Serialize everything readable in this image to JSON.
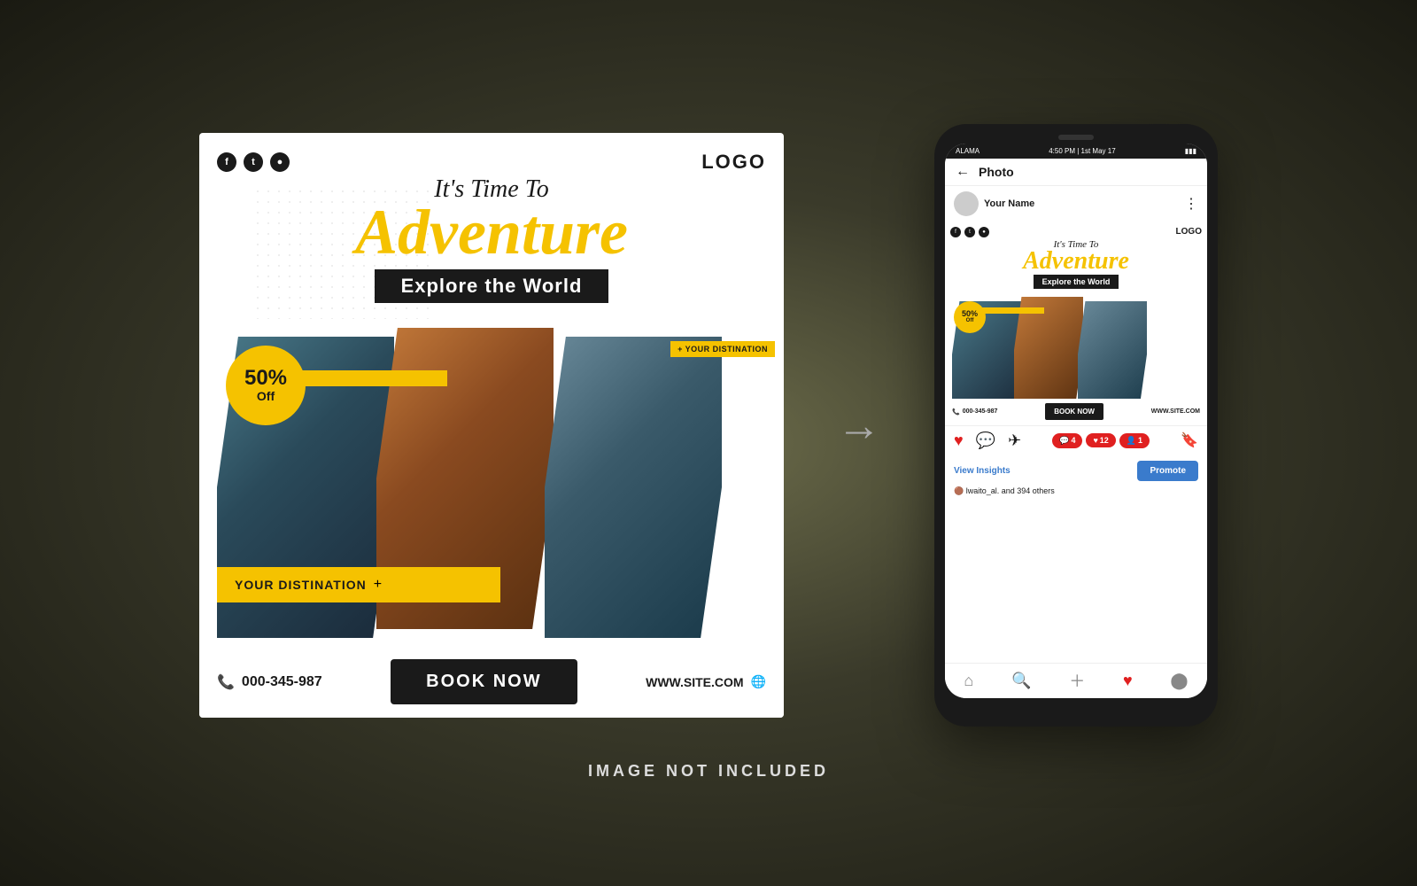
{
  "background": {
    "color": "#3a3a2a"
  },
  "left_card": {
    "social_icons": [
      "f",
      "t",
      "in"
    ],
    "logo": "LOGO",
    "its_time": "It's Time To",
    "adventure": "Adventure",
    "explore": "Explore the World",
    "discount_pct": "50%",
    "discount_off": "Off",
    "your_destination": "YOUR DISTINATION",
    "phone": "000-345-987",
    "book_now": "BOOK NOW",
    "website": "WWW.SITE.COM",
    "your_destination_corner": "+ YOUR DISTINATION"
  },
  "arrow": "→",
  "phone": {
    "status": {
      "left": "ALAMA",
      "center": "4:50 PM | 1st May 17"
    },
    "nav_title": "Photo",
    "user_name": "Your Name",
    "mini_card": {
      "logo": "LOGO",
      "its_time": "It's Time To",
      "adventure": "Adventure",
      "explore": "Explore the World",
      "discount_pct": "50%",
      "discount_off": "Off",
      "phone": "000-345-987",
      "book_now": "BOOK NOW",
      "website": "WWW.SITE.COM"
    },
    "view_insights": "View Insights",
    "promote": "Promote",
    "likes": "lwaito_al. and 394 others",
    "notification_badges": {
      "comment": "4",
      "heart": "12",
      "user": "1"
    }
  },
  "bottom_text": "IMAGE NOT INCLUDED"
}
